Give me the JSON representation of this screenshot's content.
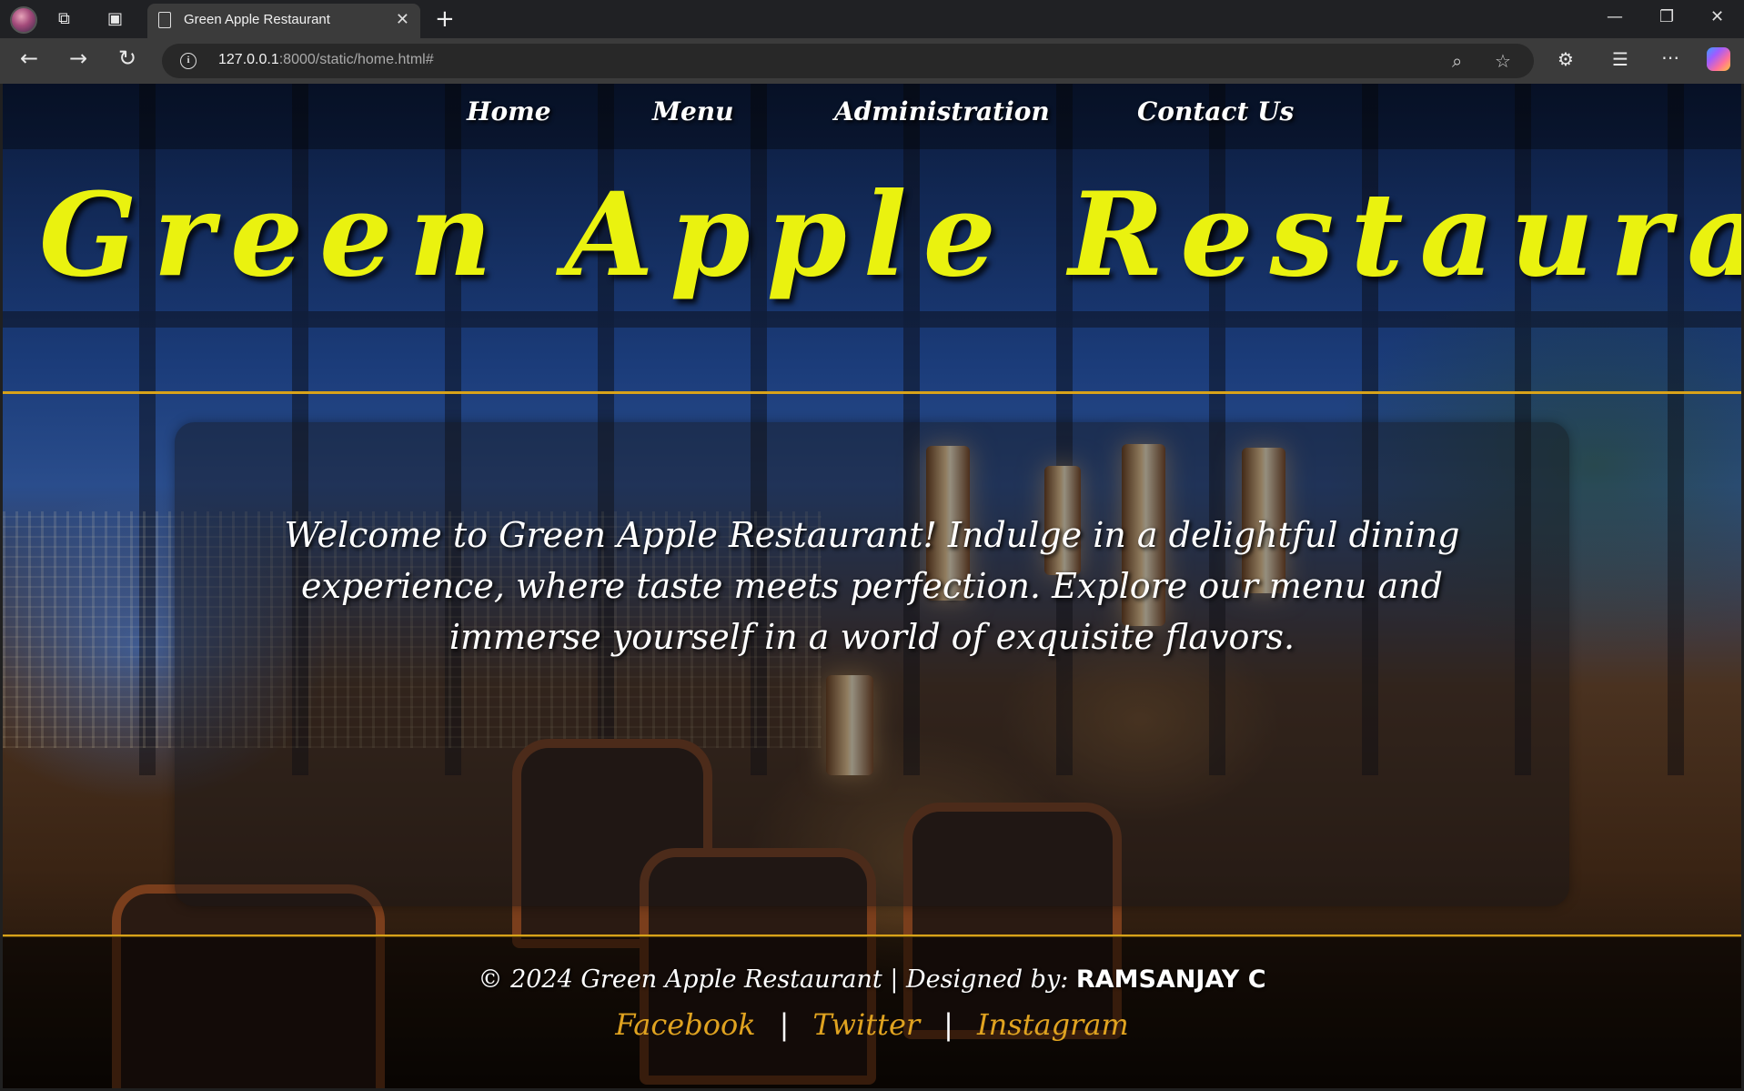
{
  "browser": {
    "tab_title": "Green Apple Restaurant",
    "url_host": "127.0.0.1",
    "url_rest": ":8000/static/home.html#"
  },
  "nav": {
    "items": [
      {
        "label": "Home"
      },
      {
        "label": "Menu"
      },
      {
        "label": "Administration"
      },
      {
        "label": "Contact Us"
      }
    ]
  },
  "hero": {
    "title": "Green Apple Restaurant"
  },
  "welcome": {
    "text": "Welcome to Green Apple Restaurant! Indulge in a delightful dining experience, where taste meets perfection. Explore our menu and immerse yourself in a world of exquisite flavors."
  },
  "footer": {
    "copyright": "© 2024 Green Apple Restaurant | Designed by: ",
    "designer": "RAMSANJAY C",
    "links": [
      {
        "label": "Facebook"
      },
      {
        "label": "Twitter"
      },
      {
        "label": "Instagram"
      }
    ],
    "separator": "|"
  },
  "colors": {
    "title": "#eaf20f",
    "divider": "#d8a21a",
    "link": "#e0a320"
  }
}
